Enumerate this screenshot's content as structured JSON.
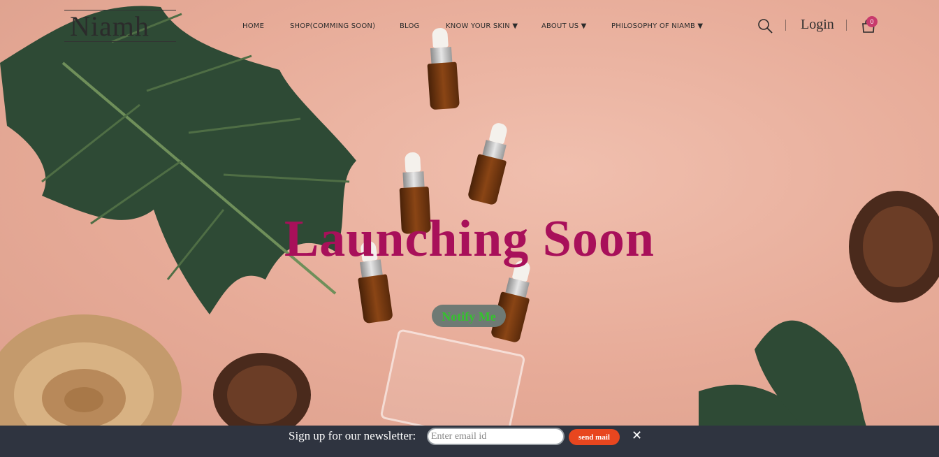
{
  "brand": {
    "logo_text": "Niamh"
  },
  "nav": {
    "items": [
      {
        "label": "HOME"
      },
      {
        "label": "SHOP(COMMING SOON)"
      },
      {
        "label": "BLOG"
      },
      {
        "label": "KNOW YOUR SKIN ▼"
      },
      {
        "label": "ABOUT US ▼"
      },
      {
        "label": "PHILOSOPHY OF NIAMB ▼"
      }
    ]
  },
  "header": {
    "search_icon": "search-icon",
    "login_label": "Login",
    "cart_icon": "shopping-bag-icon",
    "cart_count": "0"
  },
  "hero": {
    "headline": "Launching Soon",
    "notify_label": "Notify Me"
  },
  "newsletter": {
    "label": "Sign up for our newsletter:",
    "email_placeholder": "Enter email id",
    "send_label": "send mail",
    "close_symbol": "✕"
  },
  "colors": {
    "headline": "#a8105a",
    "notify_text": "#35c22f",
    "send_button": "#e8461f",
    "newsletter_bar": "#2f3440",
    "cart_badge": "#c83a6c"
  }
}
